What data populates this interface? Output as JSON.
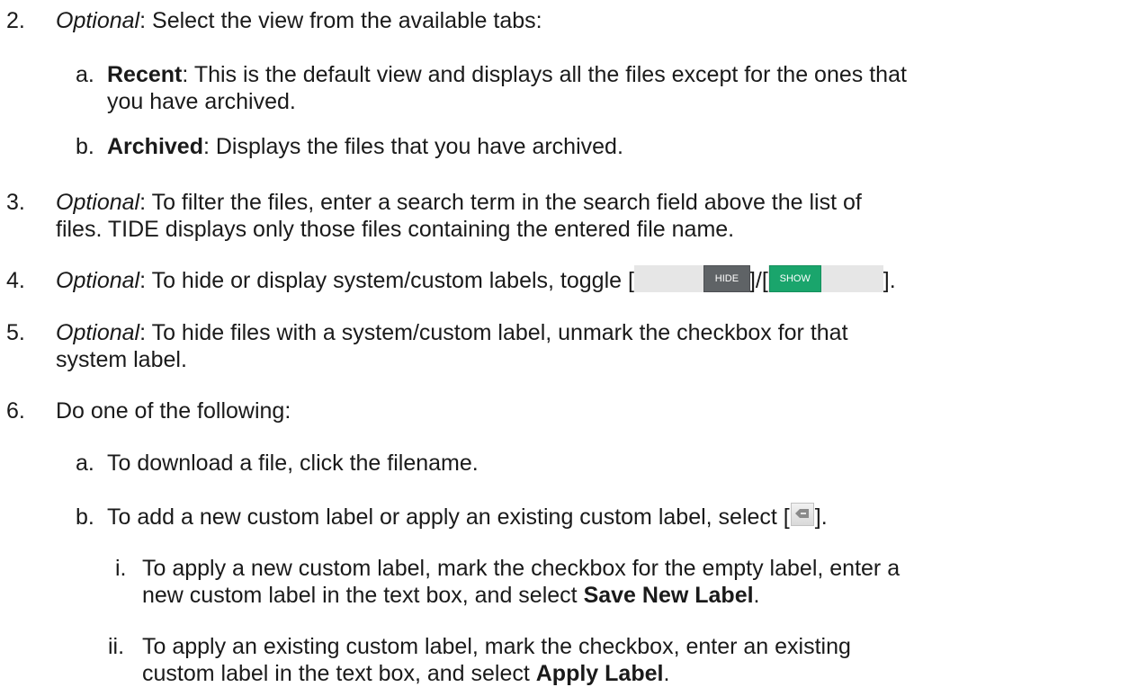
{
  "step2": {
    "num": "2.",
    "lead": "Optional",
    "text": ": Select the view from the available tabs:",
    "a": {
      "num": "a.",
      "lead": "Recent",
      "text1": ": This is the default view and displays all the files except for the ones that",
      "text2": "you have archived."
    },
    "b": {
      "num": "b.",
      "lead": "Archived",
      "text": ": Displays the files that you have archived."
    }
  },
  "step3": {
    "num": "3.",
    "lead": "Optional",
    "text1": ": To filter the files, enter a search term in the search field above the list of",
    "text2": "files. TIDE displays only those files containing the entered file name."
  },
  "step4": {
    "num": "4.",
    "lead": "Optional",
    "text": ": To hide or display system/custom labels, toggle [",
    "sep": "]/[",
    "end": "].",
    "hide_label": "HIDE",
    "show_label": "SHOW"
  },
  "step5": {
    "num": "5.",
    "lead": "Optional",
    "text1": ": To hide files with a system/custom label, unmark the checkbox for that",
    "text2": "system label."
  },
  "step6": {
    "num": "6.",
    "text": "Do one of the following:",
    "a": {
      "num": "a.",
      "text": "To download a file, click the filename."
    },
    "b": {
      "num": "b.",
      "text": "To add a new custom label or apply an existing custom label, select [",
      "end": "].",
      "i": {
        "num": "i.",
        "text1": "To apply a new custom label, mark the checkbox for the empty label, enter a",
        "text2a": "new custom label in the text box, and select ",
        "text2b": "Save New Label",
        "text2c": "."
      },
      "ii": {
        "num": "ii.",
        "text1": "To apply an existing custom label, mark the checkbox, enter an existing",
        "text2a": "custom label in the text box, and select ",
        "text2b": "Apply Label",
        "text2c": "."
      }
    }
  },
  "icons": {
    "label_button": "tag-icon"
  },
  "colors": {
    "hide_bg": "#5f6366",
    "show_bg": "#1aa56c",
    "toggle_track": "#e6e6e6"
  }
}
